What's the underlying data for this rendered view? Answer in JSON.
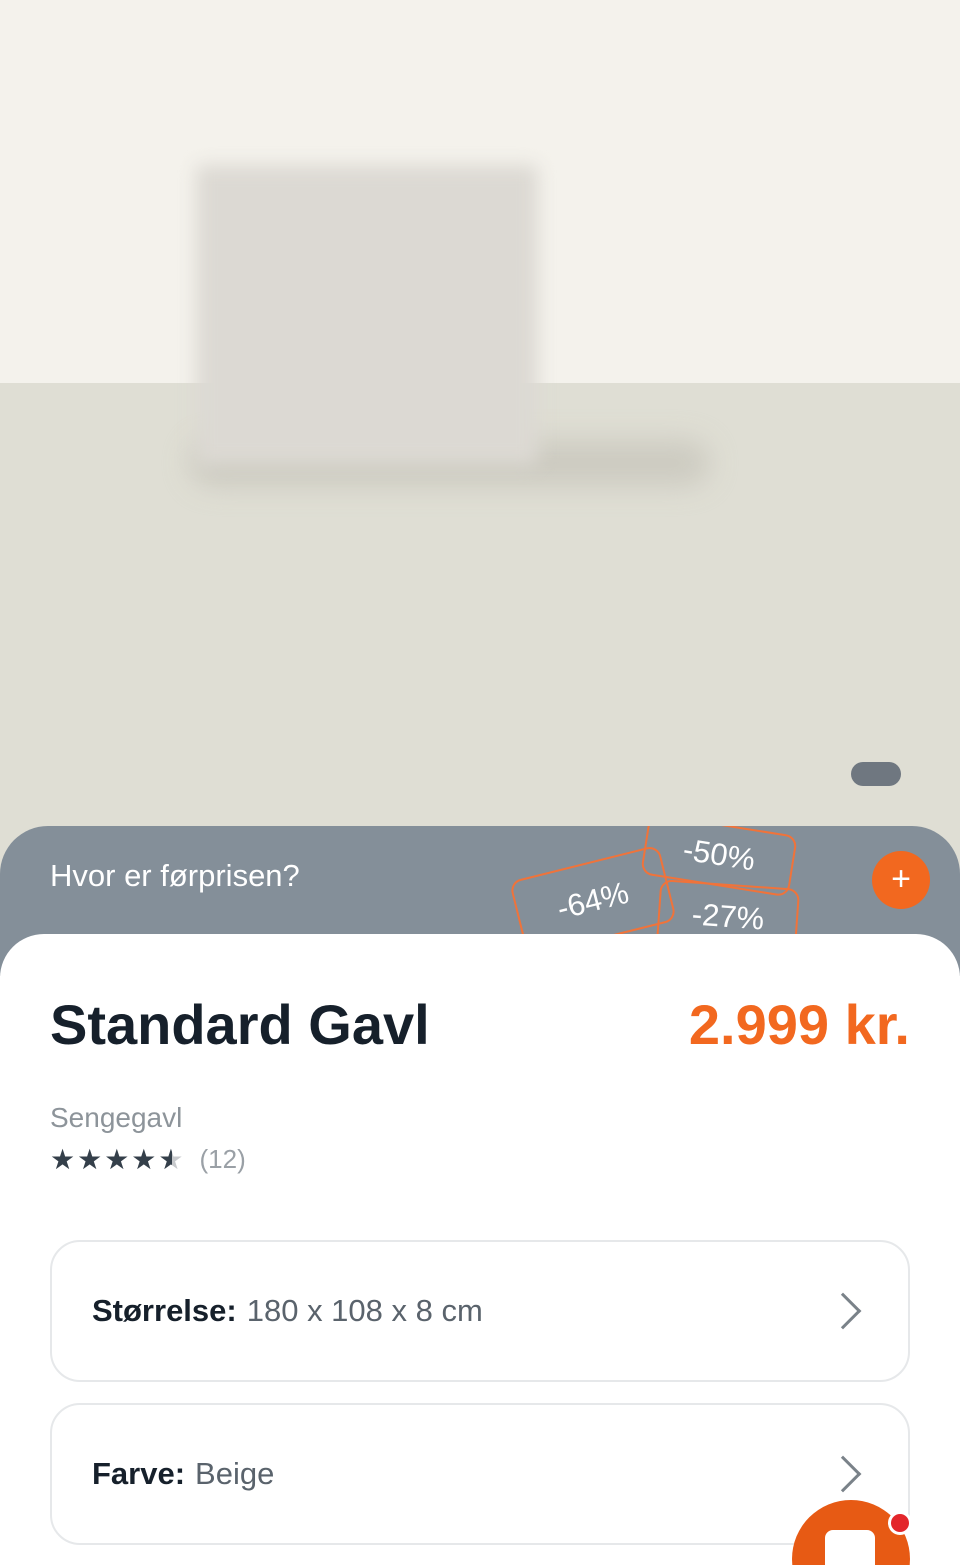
{
  "promo": {
    "text": "Hvor er førprisen?",
    "tags": [
      "-64%",
      "-50%",
      "-27%"
    ]
  },
  "product": {
    "title": "Standard Gavl",
    "price": "2.999 kr.",
    "category": "Sengegavl",
    "rating": 4.5,
    "rating_max": 5,
    "review_count": "(12)"
  },
  "options": {
    "size": {
      "label": "Størrelse:",
      "value": "180 x 108 x 8 cm"
    },
    "color": {
      "label": "Farve:",
      "value": "Beige"
    }
  },
  "colors": {
    "accent": "#f2681f",
    "promo_bg": "#848f99"
  },
  "icons": {
    "plus": "plus-icon",
    "chevron": "chevron-right-icon",
    "star": "star-icon",
    "chat": "chat-icon"
  }
}
